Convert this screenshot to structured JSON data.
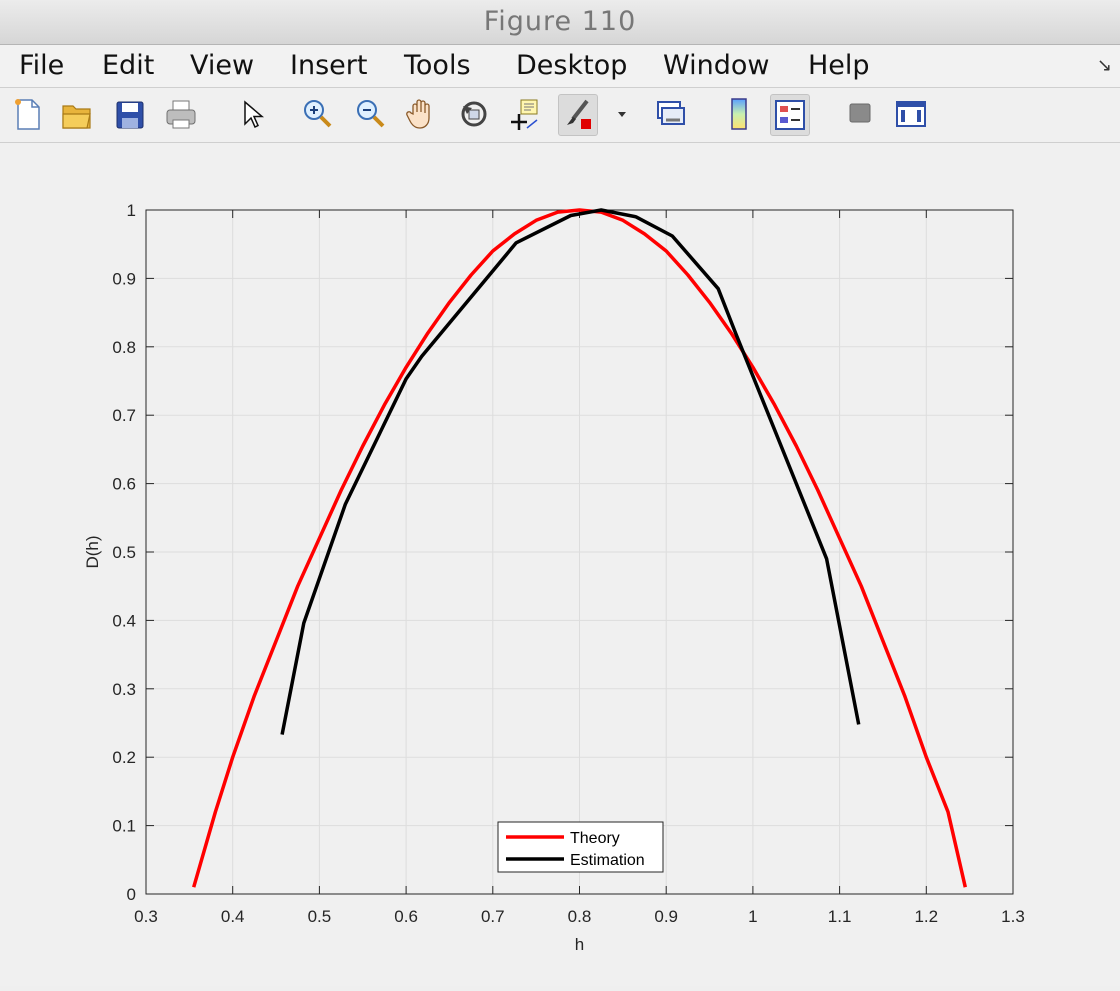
{
  "window": {
    "title": "Figure 110"
  },
  "menu": [
    "File",
    "Edit",
    "View",
    "Insert",
    "Tools",
    "Desktop",
    "Window",
    "Help"
  ],
  "toolbar_icons": [
    "new-file-icon",
    "open-folder-icon",
    "save-icon",
    "print-icon",
    "pointer-icon",
    "zoom-in-icon",
    "zoom-out-icon",
    "pan-hand-icon",
    "rotate-3d-icon",
    "data-cursor-icon",
    "brush-icon",
    "dropdown-arrow-icon",
    "link-plot-icon",
    "colorbar-icon",
    "legend-icon",
    "hide-plot-tools-icon",
    "show-plot-tools-icon"
  ],
  "colors": {
    "theory": "#ff0000",
    "estimation": "#000000",
    "grid": "#dddddd"
  },
  "chart_data": {
    "type": "line",
    "xlabel": "h",
    "ylabel": "D(h)",
    "xlim": [
      0.3,
      1.3
    ],
    "ylim": [
      0,
      1
    ],
    "xticks": [
      "0.3",
      "0.4",
      "0.5",
      "0.6",
      "0.7",
      "0.8",
      "0.9",
      "1",
      "1.1",
      "1.2",
      "1.3"
    ],
    "yticks": [
      "0",
      "0.1",
      "0.2",
      "0.3",
      "0.4",
      "0.5",
      "0.6",
      "0.7",
      "0.8",
      "0.9",
      "1"
    ],
    "grid": true,
    "legend_position": "bottom-center",
    "series": [
      {
        "name": "Theory",
        "color": "#ff0000",
        "x": [
          0.355,
          0.38,
          0.4,
          0.425,
          0.45,
          0.475,
          0.5,
          0.525,
          0.55,
          0.575,
          0.6,
          0.625,
          0.65,
          0.675,
          0.7,
          0.725,
          0.75,
          0.775,
          0.8,
          0.825,
          0.85,
          0.875,
          0.9,
          0.925,
          0.95,
          0.975,
          1.0,
          1.025,
          1.05,
          1.075,
          1.1,
          1.125,
          1.15,
          1.175,
          1.2,
          1.225,
          1.245
        ],
        "y": [
          0.01,
          0.12,
          0.2,
          0.29,
          0.37,
          0.45,
          0.52,
          0.59,
          0.655,
          0.715,
          0.77,
          0.82,
          0.865,
          0.905,
          0.94,
          0.965,
          0.985,
          0.997,
          1.0,
          0.997,
          0.985,
          0.965,
          0.94,
          0.905,
          0.865,
          0.82,
          0.77,
          0.715,
          0.655,
          0.59,
          0.52,
          0.45,
          0.37,
          0.29,
          0.2,
          0.12,
          0.01
        ]
      },
      {
        "name": "Estimation",
        "color": "#000000",
        "x": [
          0.457,
          0.482,
          0.53,
          0.6,
          0.618,
          0.727,
          0.79,
          0.825,
          0.865,
          0.907,
          0.96,
          0.98,
          1.085,
          1.122
        ],
        "y": [
          0.233,
          0.396,
          0.57,
          0.753,
          0.786,
          0.952,
          0.992,
          1.0,
          0.99,
          0.962,
          0.885,
          0.82,
          0.49,
          0.248
        ]
      }
    ]
  }
}
